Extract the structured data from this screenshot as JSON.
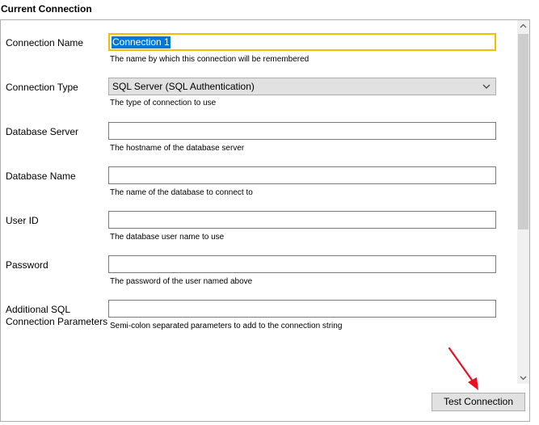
{
  "section": {
    "title": "Current Connection"
  },
  "fields": {
    "connection_name": {
      "label": "Connection Name",
      "value": "Connection 1",
      "hint": "The name by which this connection will be remembered"
    },
    "connection_type": {
      "label": "Connection Type",
      "value": "SQL Server (SQL Authentication)",
      "hint": "The type of connection to use"
    },
    "database_server": {
      "label": "Database Server",
      "value": "",
      "hint": "The hostname of the database server"
    },
    "database_name": {
      "label": "Database Name",
      "value": "",
      "hint": "The name of the database to connect to"
    },
    "user_id": {
      "label": "User ID",
      "value": "",
      "hint": "The database user name to use"
    },
    "password": {
      "label": "Password",
      "value": "",
      "hint": "The password of the user named above"
    },
    "additional_params": {
      "label_line1": "Additional SQL",
      "label_line2": "Connection Parameters",
      "value": "",
      "hint": "Semi-colon separated parameters to add to the connection string"
    }
  },
  "buttons": {
    "test_connection": "Test Connection"
  },
  "colors": {
    "focus_border": "#f0c000",
    "selection": "#0078d7",
    "annotation_arrow": "#e81123"
  },
  "icons": {
    "dropdown": "chevron-down-icon",
    "scroll_up": "scroll-up-arrow-icon",
    "scroll_down": "scroll-down-arrow-icon",
    "annotation": "red-arrow-icon"
  }
}
